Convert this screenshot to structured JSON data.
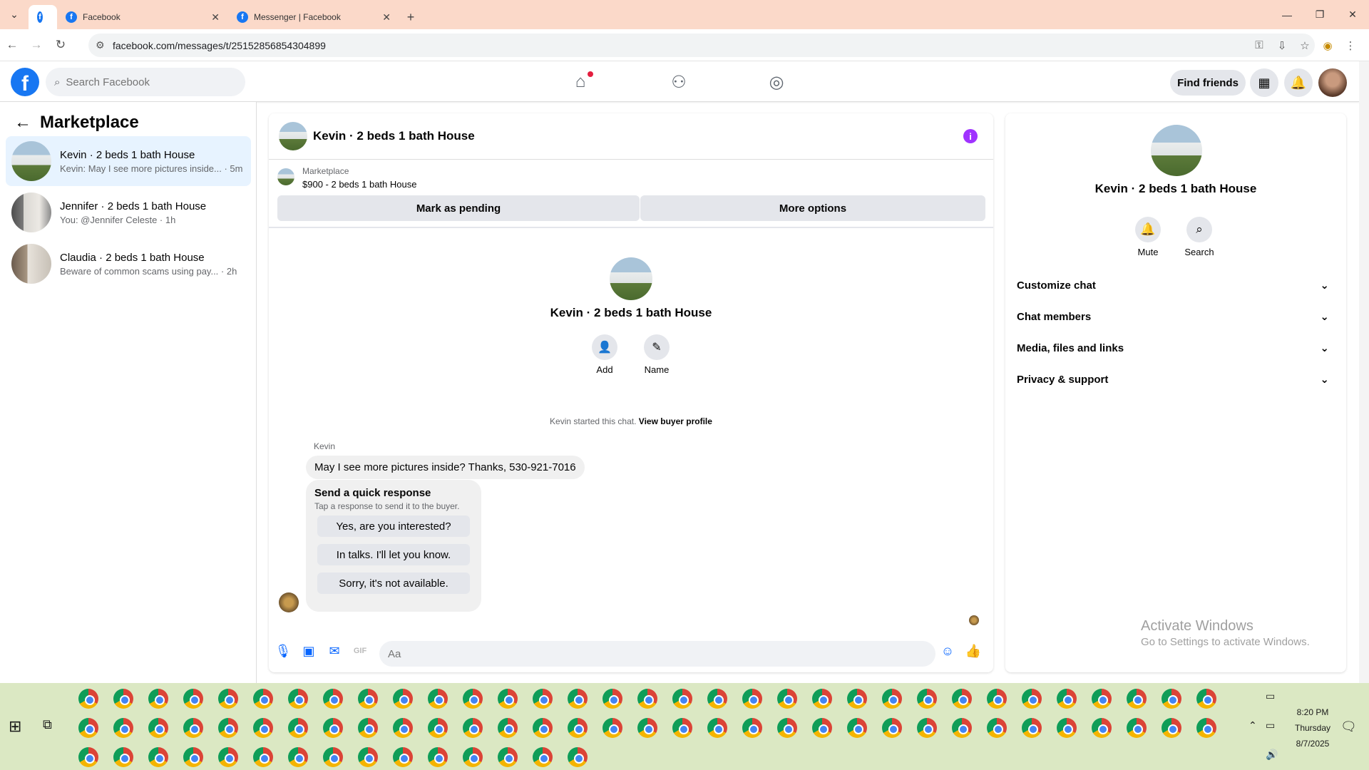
{
  "browser": {
    "tabs": [
      {
        "title": "Facebook",
        "icon": "facebook-icon"
      },
      {
        "title": "Messenger | Facebook",
        "icon": "facebook-icon"
      }
    ],
    "url": "facebook.com/messages/t/25152856854304899"
  },
  "header": {
    "search_placeholder": "Search Facebook",
    "find_friends": "Find friends"
  },
  "sidebar": {
    "title": "Marketplace",
    "conversations": [
      {
        "title": "Kevin · 2 beds 1 bath House",
        "snippet": "Kevin: May I see more pictures inside... · 5m"
      },
      {
        "title": "Jennifer · 2 beds 1 bath House",
        "snippet": "You: @Jennifer Celeste · 1h"
      },
      {
        "title": "Claudia · 2 beds 1 bath House",
        "snippet": "Beware of common scams using pay... · 2h"
      }
    ]
  },
  "chat": {
    "title": "Kevin · 2 beds 1 bath House",
    "listing_label": "Marketplace",
    "listing_title": "$900 - 2 beds 1 bath House",
    "mark_pending": "Mark as pending",
    "more_options": "More options",
    "profile_name": "Kevin · 2 beds 1 bath House",
    "add_label": "Add",
    "name_label": "Name",
    "started_text": "Kevin started this chat.",
    "view_buyer_profile": "View buyer profile",
    "sender_name": "Kevin",
    "message": "May I see more pictures inside? Thanks, 530-921-7016",
    "quick_title": "Send a quick response",
    "quick_sub": "Tap a response to send it to the buyer.",
    "quick_responses": [
      "Yes, are you interested?",
      "In talks. I'll let you know.",
      "Sorry, it's not available."
    ],
    "composer_placeholder": "Aa"
  },
  "details": {
    "name": "Kevin · 2 beds 1 bath House",
    "mute": "Mute",
    "search": "Search",
    "sections": [
      "Customize chat",
      "Chat members",
      "Media, files and links",
      "Privacy & support"
    ]
  },
  "watermark": {
    "line1": "Activate Windows",
    "line2": "Go to Settings to activate Windows."
  },
  "taskbar": {
    "time": "8:20 PM",
    "day": "Thursday",
    "date": "8/7/2025"
  },
  "colors": {
    "facebook_blue": "#1877f2",
    "messenger_blue": "#0866ff",
    "tabbar": "#fbd9c9",
    "taskbar": "#dbe8c3"
  }
}
